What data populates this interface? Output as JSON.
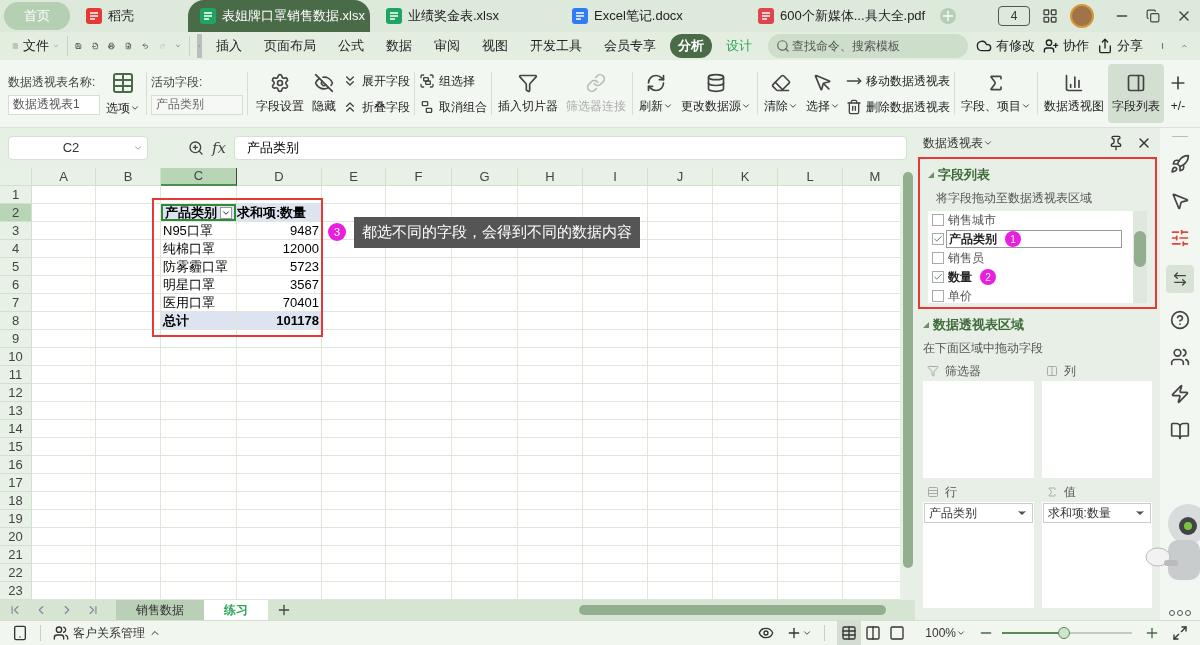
{
  "tabs": [
    {
      "label": "首页",
      "kind": "home",
      "selected": false
    },
    {
      "label": "稻壳",
      "kind": "docer",
      "selected": false
    },
    {
      "label": "表姐牌口罩销售数据.xlsx",
      "kind": "sheet",
      "selected": true
    },
    {
      "label": "业绩奖金表.xlsx",
      "kind": "sheet",
      "selected": false
    },
    {
      "label": "Excel笔记.docx",
      "kind": "writer",
      "selected": false
    },
    {
      "label": "600个新媒体...具大全.pdf",
      "kind": "pdf",
      "selected": false
    }
  ],
  "device_count": "4",
  "menu": {
    "file": "文件",
    "items": [
      {
        "label": "插入",
        "contextual": false,
        "selected": false
      },
      {
        "label": "页面布局",
        "contextual": false,
        "selected": false
      },
      {
        "label": "公式",
        "contextual": false,
        "selected": false
      },
      {
        "label": "数据",
        "contextual": false,
        "selected": false
      },
      {
        "label": "审阅",
        "contextual": false,
        "selected": false
      },
      {
        "label": "视图",
        "contextual": false,
        "selected": false
      },
      {
        "label": "开发工具",
        "contextual": false,
        "selected": false
      },
      {
        "label": "会员专享",
        "contextual": false,
        "selected": false
      },
      {
        "label": "分析",
        "contextual": true,
        "selected": true
      },
      {
        "label": "设计",
        "contextual": true,
        "selected": false
      }
    ],
    "search": {
      "placeholder": "查找命令、搜索模板"
    },
    "actions": [
      "有修改",
      "协作",
      "分享"
    ]
  },
  "ribbon": {
    "name_label": "数据透视表名称:",
    "name_value": "数据透视表1",
    "options": "选项",
    "active_label": "活动字段:",
    "active_value": "产品类别",
    "groups": [
      [
        {
          "kind": "big",
          "label": "字段设置",
          "dropdown": false,
          "disabled": false,
          "selected": false
        },
        {
          "kind": "big",
          "label": "隐藏",
          "dropdown": false,
          "disabled": false,
          "selected": false
        },
        {
          "kind": "stack",
          "items": [
            "展开字段",
            "折叠字段"
          ]
        }
      ],
      [
        {
          "kind": "stack",
          "items": [
            "组选择",
            "取消组合"
          ]
        }
      ],
      [
        {
          "kind": "big",
          "label": "插入切片器",
          "dropdown": false,
          "disabled": false,
          "selected": false
        },
        {
          "kind": "big",
          "label": "筛选器连接",
          "dropdown": false,
          "disabled": true,
          "selected": false
        }
      ],
      [
        {
          "kind": "big",
          "label": "刷新",
          "dropdown": true,
          "disabled": false,
          "selected": false
        },
        {
          "kind": "big",
          "label": "更改数据源",
          "dropdown": true,
          "disabled": false,
          "selected": false
        }
      ],
      [
        {
          "kind": "big",
          "label": "清除",
          "dropdown": true,
          "disabled": false,
          "selected": false
        },
        {
          "kind": "big",
          "label": "选择",
          "dropdown": true,
          "disabled": false,
          "selected": false
        },
        {
          "kind": "stack",
          "items": [
            "移动数据透视表",
            "删除数据透视表"
          ]
        }
      ],
      [
        {
          "kind": "big",
          "label": "字段、项目",
          "dropdown": true,
          "disabled": false,
          "selected": false
        }
      ],
      [
        {
          "kind": "big",
          "label": "数据透视图",
          "dropdown": false,
          "disabled": false,
          "selected": false
        },
        {
          "kind": "big",
          "label": "字段列表",
          "dropdown": false,
          "disabled": false,
          "selected": true
        },
        {
          "kind": "big",
          "label": "+/-",
          "dropdown": false,
          "disabled": false,
          "selected": false
        }
      ]
    ]
  },
  "formula_bar": {
    "cell": "C2",
    "function_label": "fx",
    "value": "产品类别"
  },
  "columns": [
    {
      "label": "A",
      "selected": false
    },
    {
      "label": "B",
      "selected": false
    },
    {
      "label": "C",
      "selected": true
    },
    {
      "label": "D",
      "selected": false
    },
    {
      "label": "E",
      "selected": false
    },
    {
      "label": "F",
      "selected": false
    },
    {
      "label": "G",
      "selected": false
    },
    {
      "label": "H",
      "selected": false
    },
    {
      "label": "I",
      "selected": false
    },
    {
      "label": "J",
      "selected": false
    },
    {
      "label": "K",
      "selected": false
    },
    {
      "label": "L",
      "selected": false
    },
    {
      "label": "M",
      "selected": false
    }
  ],
  "rows": [
    {
      "label": "1",
      "selected": false
    },
    {
      "label": "2",
      "selected": true
    },
    {
      "label": "3",
      "selected": false
    },
    {
      "label": "4",
      "selected": false
    },
    {
      "label": "5",
      "selected": false
    },
    {
      "label": "6",
      "selected": false
    },
    {
      "label": "7",
      "selected": false
    },
    {
      "label": "8",
      "selected": false
    },
    {
      "label": "9",
      "selected": false
    },
    {
      "label": "10",
      "selected": false
    },
    {
      "label": "11",
      "selected": false
    },
    {
      "label": "12",
      "selected": false
    },
    {
      "label": "13",
      "selected": false
    },
    {
      "label": "14",
      "selected": false
    },
    {
      "label": "15",
      "selected": false
    },
    {
      "label": "16",
      "selected": false
    },
    {
      "label": "17",
      "selected": false
    },
    {
      "label": "18",
      "selected": false
    },
    {
      "label": "19",
      "selected": false
    },
    {
      "label": "20",
      "selected": false
    },
    {
      "label": "21",
      "selected": false
    },
    {
      "label": "22",
      "selected": false
    },
    {
      "label": "23",
      "selected": false
    }
  ],
  "pivot": {
    "header": [
      "产品类别",
      "求和项:数量"
    ],
    "rows": [
      {
        "label": "N95口罩",
        "value": "9487"
      },
      {
        "label": "纯棉口罩",
        "value": "12000"
      },
      {
        "label": "防雾霾口罩",
        "value": "5723"
      },
      {
        "label": "明星口罩",
        "value": "3567"
      },
      {
        "label": "医用口罩",
        "value": "70401"
      }
    ],
    "total": {
      "label": "总计",
      "value": "101178"
    }
  },
  "callout": {
    "badge": "3",
    "text": "都选不同的字段，会得到不同的数据内容"
  },
  "sheets": [
    {
      "label": "销售数据",
      "selected": false
    },
    {
      "label": "练习",
      "selected": true
    }
  ],
  "pane": {
    "title": "数据透视表",
    "field_list_title": "字段列表",
    "field_hint": "将字段拖动至数据透视表区域",
    "fields": [
      {
        "label": "销售城市",
        "checked": false,
        "selected": false
      },
      {
        "label": "产品类别",
        "checked": true,
        "selected": true,
        "badge": "1"
      },
      {
        "label": "销售员",
        "checked": false,
        "selected": false
      },
      {
        "label": "数量",
        "checked": true,
        "selected": false,
        "badge": "2"
      },
      {
        "label": "单价",
        "checked": false,
        "selected": false
      }
    ],
    "areas_title": "数据透视表区域",
    "areas_hint": "在下面区域中拖动字段",
    "areas": [
      {
        "kind": "filter",
        "label": "筛选器"
      },
      {
        "kind": "column",
        "label": "列"
      },
      {
        "kind": "row",
        "label": "行",
        "items": [
          "产品类别"
        ]
      },
      {
        "kind": "value",
        "label": "值",
        "items": [
          "求和项:数量"
        ]
      }
    ]
  },
  "status": {
    "app": "客户关系管理",
    "zoom": "100%",
    "level": 0.48,
    "views": [
      {
        "kind": "normal",
        "selected": true
      },
      {
        "kind": "page_layout",
        "selected": false
      },
      {
        "kind": "page_break",
        "selected": false
      }
    ]
  }
}
